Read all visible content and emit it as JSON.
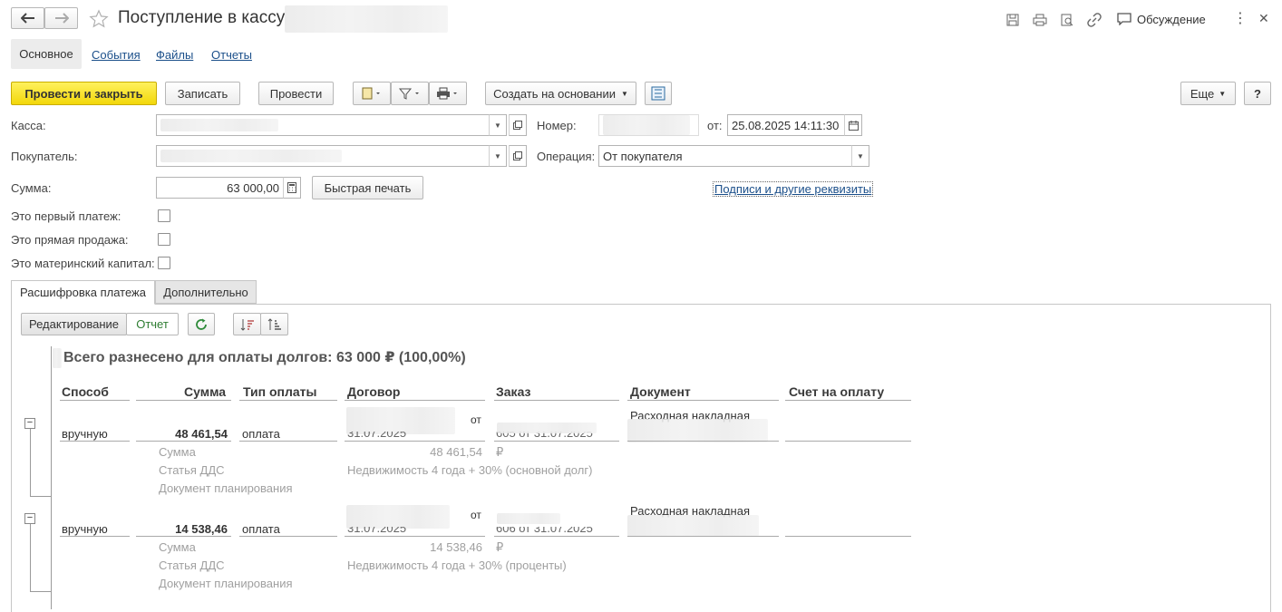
{
  "window": {
    "title": "Поступление в кассу",
    "discussion": "Обсуждение"
  },
  "navtabs": [
    "Основное",
    "События",
    "Файлы",
    "Отчеты"
  ],
  "toolbar": {
    "post_close": "Провести и закрыть",
    "save": "Записать",
    "post": "Провести",
    "create_based": "Создать на основании",
    "more": "Еще",
    "help": "?"
  },
  "form": {
    "kassa_label": "Касса:",
    "number_label": "Номер:",
    "from_label": "от:",
    "date_value": "25.08.2025 14:11:30",
    "buyer_label": "Покупатель:",
    "operation_label": "Операция:",
    "operation_value": "От покупателя",
    "sum_label": "Сумма:",
    "sum_value": "63 000,00",
    "quick_print": "Быстрая печать",
    "signatures_link": "Подписи и другие реквизиты",
    "first_payment": "Это первый платеж:",
    "direct_sale": "Это прямая продажа:",
    "maternity_capital": "Это материнский капитал:"
  },
  "subtabs": [
    "Расшифровка платежа",
    "Дополнительно"
  ],
  "panel": {
    "mode_edit": "Редактирование",
    "mode_report": "Отчет",
    "summary": "Всего разнесено для оплаты долгов: 63 000 ₽ (100,00%)",
    "columns": [
      "Способ",
      "Сумма",
      "Тип оплаты",
      "Договор",
      "Заказ",
      "Документ",
      "Счет на оплату"
    ],
    "rows": [
      {
        "method": "вручную",
        "sum": "48 461,54",
        "pay_type": "оплата",
        "contract_from": "от",
        "contract_date": "31.07.2025",
        "order": "605 от 31.07.2025",
        "document": "Расходная накладная",
        "sub_sum_label": "Сумма",
        "sub_sum_value": "48 461,54",
        "currency": "₽",
        "dds_label": "Статья ДДС",
        "dds_value": "Недвижимость 4 года + 30% (основной долг)",
        "plan_label": "Документ планирования"
      },
      {
        "method": "вручную",
        "sum": "14 538,46",
        "pay_type": "оплата",
        "contract_from": "от",
        "contract_date": "31.07.2025",
        "order": "606 от 31.07.2025",
        "document": "Расходная накладная",
        "sub_sum_label": "Сумма",
        "sub_sum_value": "14 538,46",
        "currency": "₽",
        "dds_label": "Статья ДДС",
        "dds_value": "Недвижимость 4 года + 30% (проценты)",
        "plan_label": "Документ планирования"
      }
    ]
  },
  "colors": {
    "primary": "#f6dc1b",
    "link": "#1b4f8a",
    "report_green": "#2e7d32"
  }
}
